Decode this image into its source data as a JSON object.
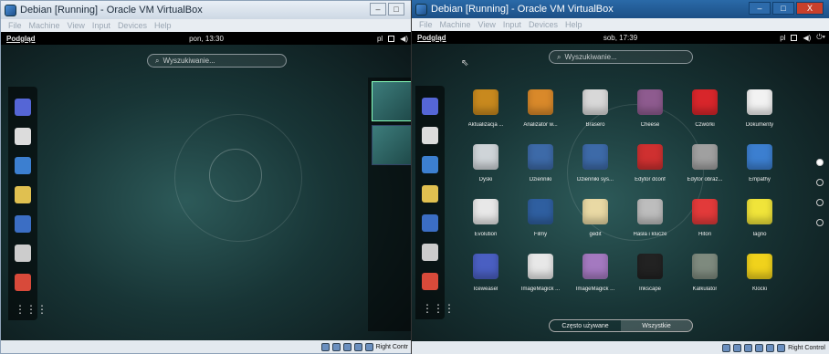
{
  "left_window": {
    "title": "Debian [Running] - Oracle VM VirtualBox",
    "menu": [
      "File",
      "Machine",
      "View",
      "Input",
      "Devices",
      "Help"
    ],
    "topbar": {
      "activities": "Podgląd",
      "clock": "pon, 13:30",
      "lang": "pl"
    },
    "search_placeholder": "Wyszukiwanie...",
    "host_key": "Right Contr"
  },
  "right_window": {
    "title": "Debian [Running] - Oracle VM VirtualBox",
    "menu": [
      "File",
      "Machine",
      "View",
      "Input",
      "Devices",
      "Help"
    ],
    "topbar": {
      "activities": "Podgląd",
      "clock": "sob, 17:39",
      "lang": "pl"
    },
    "search_placeholder": "Wyszukiwanie...",
    "apps": [
      {
        "label": "Aktualizacja ...",
        "icon": "software-update-icon",
        "color": "#c8891e"
      },
      {
        "label": "Analizator w...",
        "icon": "disk-usage-analyzer-icon",
        "color": "#d9892a"
      },
      {
        "label": "Brasero",
        "icon": "brasero-disc-icon",
        "color": "#d8d8d8"
      },
      {
        "label": "Cheese",
        "icon": "cheese-webcam-icon",
        "color": "#8e5b8f"
      },
      {
        "label": "Czwórki",
        "icon": "four-in-a-row-icon",
        "color": "#d8262b"
      },
      {
        "label": "Dokumenty",
        "icon": "documents-icon",
        "color": "#f2f2f2"
      },
      {
        "label": "Dyski",
        "icon": "disks-icon",
        "color": "#cfd4d8"
      },
      {
        "label": "Dzienniki",
        "icon": "logs-icon",
        "color": "#3d6aa8"
      },
      {
        "label": "Dzienniki sys...",
        "icon": "system-log-icon",
        "color": "#3d6aa8"
      },
      {
        "label": "Edytor dconf",
        "icon": "dconf-editor-icon",
        "color": "#cf3030"
      },
      {
        "label": "Edytor obraz...",
        "icon": "image-editor-icon",
        "color": "#a0a0a0"
      },
      {
        "label": "Empathy",
        "icon": "empathy-icon",
        "color": "#3c7fd0"
      },
      {
        "label": "Evolution",
        "icon": "evolution-icon",
        "color": "#e8e8e8"
      },
      {
        "label": "Filmy",
        "icon": "videos-icon",
        "color": "#2f5fa0"
      },
      {
        "label": "gedit",
        "icon": "gedit-icon",
        "color": "#e9d9a4"
      },
      {
        "label": "Hasła i klucze",
        "icon": "passwords-keys-icon",
        "color": "#bdbdbd"
      },
      {
        "label": "Hitori",
        "icon": "hitori-icon",
        "color": "#e23a3a"
      },
      {
        "label": "Iagno",
        "icon": "iagno-icon",
        "color": "#f0e43a"
      },
      {
        "label": "Iceweasel",
        "icon": "iceweasel-icon",
        "color": "#4a5fc2"
      },
      {
        "label": "ImageMagick ...",
        "icon": "imagemagick-icon",
        "color": "#e8e8e8"
      },
      {
        "label": "ImageMagick ...",
        "icon": "imagemagick-display-icon",
        "color": "#a479c0"
      },
      {
        "label": "Inkscape",
        "icon": "inkscape-icon",
        "color": "#222222"
      },
      {
        "label": "Kalkulator",
        "icon": "calculator-icon",
        "color": "#7e8a7e"
      },
      {
        "label": "Klocki",
        "icon": "blocks-icon",
        "color": "#f0d21c"
      }
    ],
    "tabs": {
      "frequent": "Często używane",
      "all": "Wszystkie"
    },
    "host_key": "Right Control"
  },
  "dash_icons": [
    "iceweasel-icon",
    "evolution-icon",
    "empathy-icon",
    "rhythmbox-icon",
    "writer-icon",
    "files-icon",
    "help-icon",
    "show-apps-icon"
  ],
  "dash_colors": [
    "#5566d6",
    "#dcdcdc",
    "#3c7fd0",
    "#e0c050",
    "#3b6ec4",
    "#cccccc",
    "#d84a3a",
    "#777777"
  ]
}
